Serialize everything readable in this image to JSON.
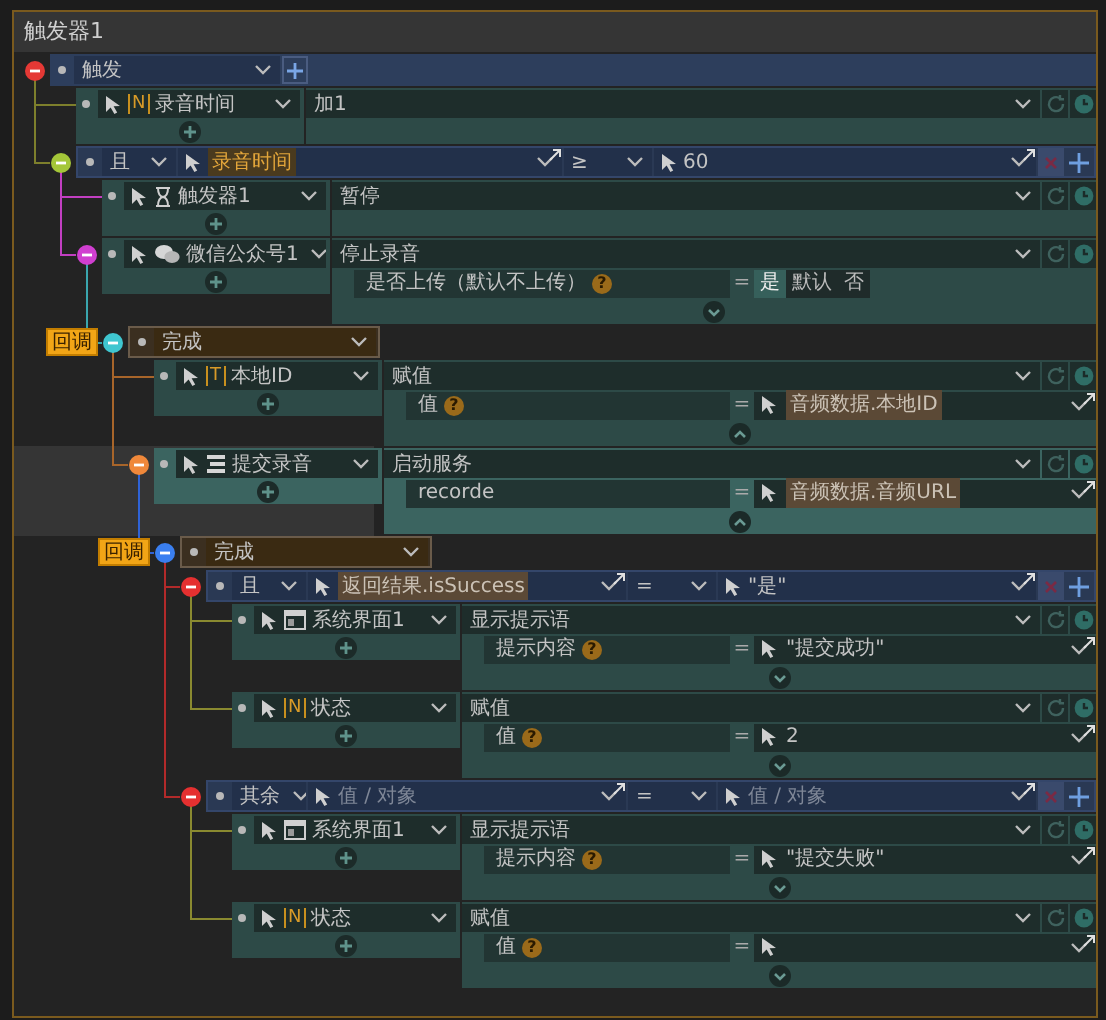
{
  "title": "触发器1",
  "trigger": {
    "label": "触发",
    "color": "#e53935",
    "branch": {
      "color": "#7d7f2c"
    },
    "children": [
      {
        "kind": "action",
        "icon": {
          "kind": "badge",
          "text": "N"
        },
        "target": "录音时间",
        "method": "加1"
      },
      {
        "kind": "condition",
        "color": "#a4c639",
        "branch": {
          "color": "#c23fc2"
        },
        "operator": "且",
        "left": {
          "text": "录音时间",
          "tagged": true,
          "variable": true
        },
        "compare": "≥",
        "right": {
          "text": "60"
        },
        "children": [
          {
            "kind": "action",
            "icon": {
              "kind": "hourglass"
            },
            "target": "触发器1",
            "method": "暂停"
          },
          {
            "kind": "action",
            "icon": {
              "kind": "chat"
            },
            "target": "微信公众号1",
            "method": "停止录音",
            "color": "#d03fd0",
            "branch": {
              "color": "#3aa6ae"
            },
            "expanded": false,
            "params": [
              {
                "label": "是否上传（默认不上传）",
                "help": "?",
                "operator": "=",
                "value": {
                  "kind": "toggle",
                  "options": [
                    {
                      "label": "是",
                      "selected": true
                    },
                    {
                      "label": "默认",
                      "selected": false
                    },
                    {
                      "label": "否",
                      "selected": false
                    }
                  ]
                }
              }
            ],
            "children": [
              {
                "kind": "callback",
                "tag": "回调",
                "label": "完成",
                "color": "#3fc6d0",
                "branch": {
                  "color": "#a8652a"
                },
                "children": [
                  {
                    "kind": "action",
                    "icon": {
                      "kind": "badge",
                      "text": "T"
                    },
                    "target": "本地ID",
                    "method": "赋值",
                    "expanded": true,
                    "params": [
                      {
                        "label": "值",
                        "help": "?",
                        "operator": "=",
                        "value": {
                          "kind": "ref",
                          "text": "音频数据.本地ID",
                          "tagged": true
                        }
                      }
                    ]
                  },
                  {
                    "kind": "action",
                    "highlighted": true,
                    "icon": {
                      "kind": "server"
                    },
                    "target": "提交录音",
                    "method": "启动服务",
                    "color": "#f0883a",
                    "branch": {
                      "color": "#2f63d6"
                    },
                    "expanded": true,
                    "params": [
                      {
                        "label": "recorde",
                        "operator": "=",
                        "value": {
                          "kind": "ref",
                          "text": "音频数据.音频URL",
                          "tagged": true
                        }
                      }
                    ],
                    "children": [
                      {
                        "kind": "callback",
                        "tag": "回调",
                        "label": "完成",
                        "color": "#3a7ff0",
                        "branch": {
                          "color": "#b22a2a"
                        },
                        "children": [
                          {
                            "kind": "condition",
                            "color": "#e53030",
                            "branch": {
                              "color": "#8a8a30"
                            },
                            "operator": "且",
                            "left": {
                              "text": "返回结果.isSuccess",
                              "tagged": true
                            },
                            "compare": "=",
                            "right": {
                              "text": "\"是\""
                            },
                            "children": [
                              {
                                "kind": "action",
                                "icon": {
                                  "kind": "window"
                                },
                                "target": "系统界面1",
                                "method": "显示提示语",
                                "expanded": false,
                                "params": [
                                  {
                                    "label": "提示内容",
                                    "help": "?",
                                    "operator": "=",
                                    "value": {
                                      "kind": "ref",
                                      "text": "\"提交成功\""
                                    }
                                  }
                                ]
                              },
                              {
                                "kind": "action",
                                "icon": {
                                  "kind": "badge",
                                  "text": "N"
                                },
                                "target": "状态",
                                "method": "赋值",
                                "expanded": false,
                                "params": [
                                  {
                                    "label": "值",
                                    "help": "?",
                                    "operator": "=",
                                    "value": {
                                      "kind": "ref",
                                      "text": "2"
                                    }
                                  }
                                ]
                              }
                            ]
                          },
                          {
                            "kind": "condition",
                            "color": "#e53030",
                            "branch": {
                              "color": "#8a8a30"
                            },
                            "operator": "其余",
                            "left": {
                              "placeholder": "值 / 对象"
                            },
                            "compare": "=",
                            "right": {
                              "placeholder": "值 / 对象"
                            },
                            "children": [
                              {
                                "kind": "action",
                                "icon": {
                                  "kind": "window"
                                },
                                "target": "系统界面1",
                                "method": "显示提示语",
                                "expanded": false,
                                "params": [
                                  {
                                    "label": "提示内容",
                                    "help": "?",
                                    "operator": "=",
                                    "value": {
                                      "kind": "ref",
                                      "text": "\"提交失败\""
                                    }
                                  }
                                ]
                              },
                              {
                                "kind": "action",
                                "icon": {
                                  "kind": "badge",
                                  "text": "N"
                                },
                                "target": "状态",
                                "method": "赋值",
                                "expanded": false,
                                "params": [
                                  {
                                    "label": "值",
                                    "help": "?",
                                    "operator": "=",
                                    "value": {
                                      "kind": "ref"
                                    }
                                  }
                                ]
                              }
                            ]
                          }
                        ]
                      }
                    ]
                  }
                ]
              }
            ]
          }
        ]
      }
    ]
  }
}
